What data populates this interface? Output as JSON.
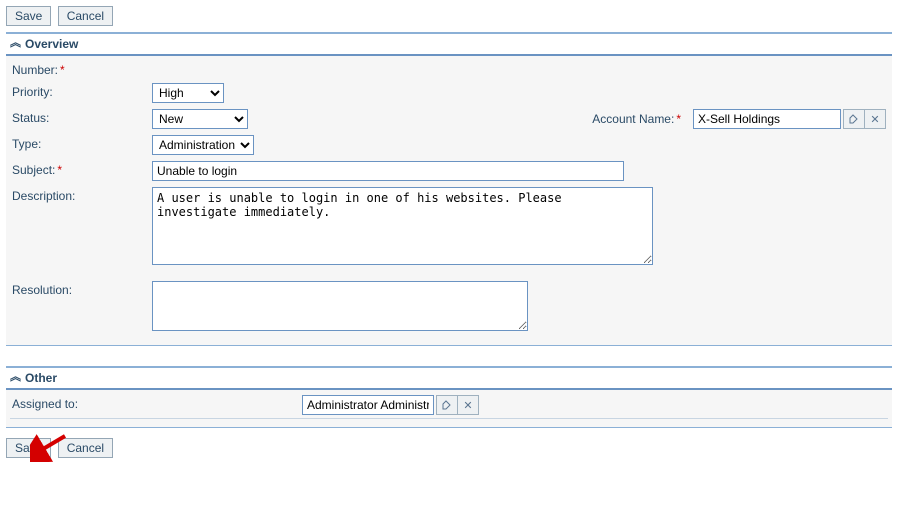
{
  "toolbar": {
    "save_label": "Save",
    "cancel_label": "Cancel"
  },
  "overview": {
    "title": "Overview",
    "number_label": "Number:",
    "priority_label": "Priority:",
    "priority_value": "High",
    "status_label": "Status:",
    "status_value": "New",
    "account_name_label": "Account Name:",
    "account_name_value": "X-Sell Holdings",
    "type_label": "Type:",
    "type_value": "Administration",
    "subject_label": "Subject:",
    "subject_value": "Unable to login",
    "description_label": "Description:",
    "description_value": "A user is unable to login in one of his websites. Please investigate immediately.",
    "resolution_label": "Resolution:",
    "resolution_value": ""
  },
  "other": {
    "title": "Other",
    "assigned_to_label": "Assigned to:",
    "assigned_to_value": "Administrator Administrator"
  },
  "footer": {
    "save_label": "Save",
    "cancel_label": "Cancel"
  }
}
